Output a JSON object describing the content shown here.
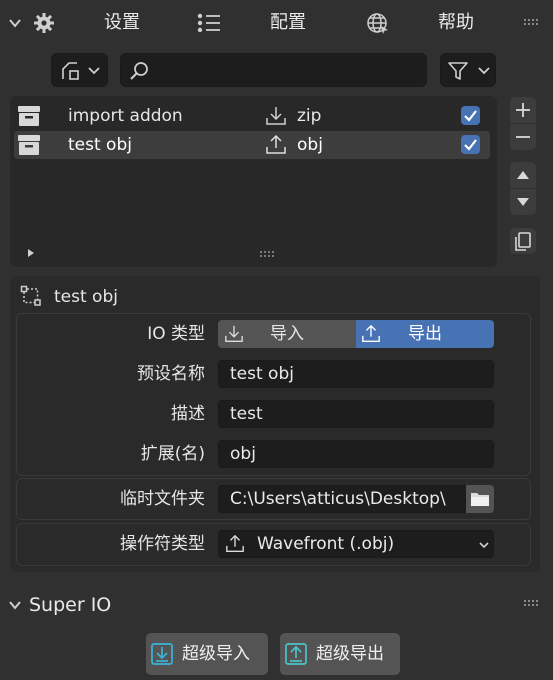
{
  "header": {
    "settings_label": "设置",
    "config_label": "配置",
    "help_label": "帮助"
  },
  "list": {
    "rows": [
      {
        "name": "import  addon",
        "ext": "zip",
        "direction": "import",
        "checked": true,
        "selected": false
      },
      {
        "name": "test obj",
        "ext": "obj",
        "direction": "export",
        "checked": true,
        "selected": true
      }
    ]
  },
  "detail": {
    "title": "test obj",
    "io_type_label": "IO 类型",
    "io_import_label": "导入",
    "io_export_label": "导出",
    "io_selected": "导出",
    "preset_name_label": "预设名称",
    "preset_name_value": "test obj",
    "desc_label": "描述",
    "desc_value": "test",
    "ext_label": "扩展(名)",
    "ext_value": "obj",
    "temp_folder_label": "临时文件夹",
    "temp_folder_value": "C:\\Users\\atticus\\Desktop\\",
    "operator_type_label": "操作符类型",
    "operator_type_value": "Wavefront (.obj)"
  },
  "super_io": {
    "title": "Super IO",
    "import_label": "超级导入",
    "export_label": "超级导出"
  },
  "colors": {
    "accent": "#4772b3",
    "panel_bg": "#303030",
    "field_bg": "#1d1d1d",
    "cyan_icon": "#39b5d8"
  }
}
